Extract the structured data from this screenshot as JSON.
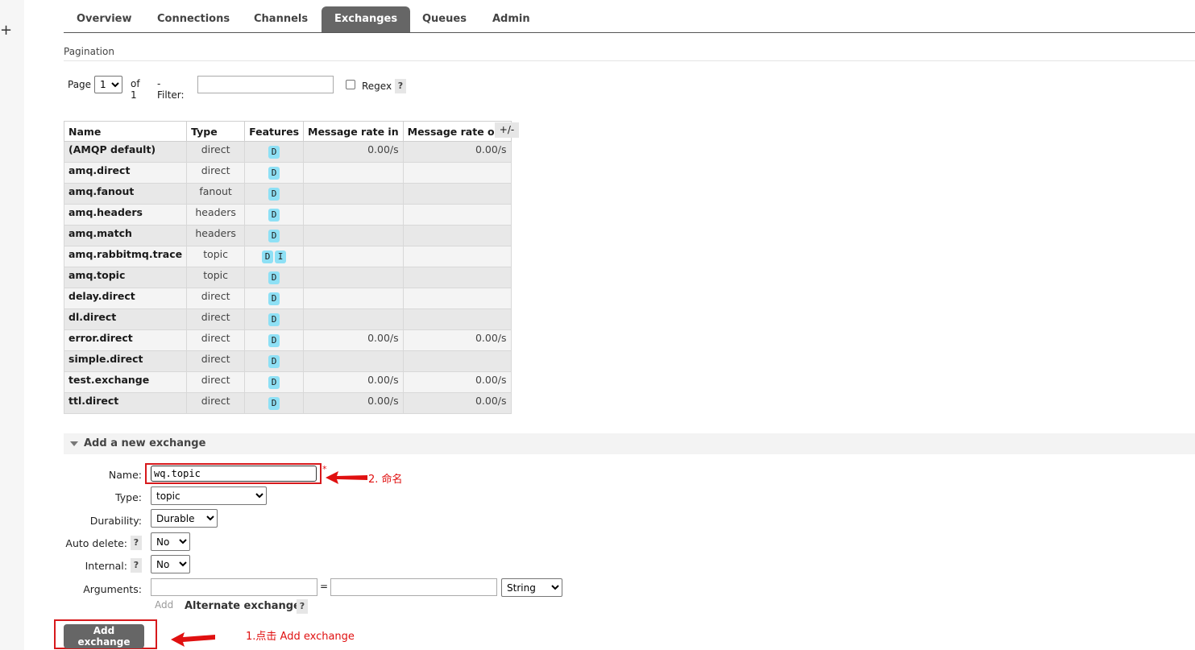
{
  "tabs": [
    "Overview",
    "Connections",
    "Channels",
    "Exchanges",
    "Queues",
    "Admin"
  ],
  "section_label": "Pagination",
  "pager": {
    "page_label": "Page",
    "page_value": "1",
    "of_label": "of 1",
    "filter_label": "- Filter:",
    "filter_value": "",
    "regex_label": "Regex",
    "help": "?"
  },
  "table": {
    "headers": [
      "Name",
      "Type",
      "Features",
      "Message rate in",
      "Message rate out"
    ],
    "toggle": "+/-",
    "rows": [
      {
        "name": "(AMQP default)",
        "type": "direct",
        "features": [
          "D"
        ],
        "rate_in": "0.00/s",
        "rate_out": "0.00/s"
      },
      {
        "name": "amq.direct",
        "type": "direct",
        "features": [
          "D"
        ],
        "rate_in": "",
        "rate_out": ""
      },
      {
        "name": "amq.fanout",
        "type": "fanout",
        "features": [
          "D"
        ],
        "rate_in": "",
        "rate_out": ""
      },
      {
        "name": "amq.headers",
        "type": "headers",
        "features": [
          "D"
        ],
        "rate_in": "",
        "rate_out": ""
      },
      {
        "name": "amq.match",
        "type": "headers",
        "features": [
          "D"
        ],
        "rate_in": "",
        "rate_out": ""
      },
      {
        "name": "amq.rabbitmq.trace",
        "type": "topic",
        "features": [
          "D",
          "I"
        ],
        "rate_in": "",
        "rate_out": ""
      },
      {
        "name": "amq.topic",
        "type": "topic",
        "features": [
          "D"
        ],
        "rate_in": "",
        "rate_out": ""
      },
      {
        "name": "delay.direct",
        "type": "direct",
        "features": [
          "D"
        ],
        "rate_in": "",
        "rate_out": ""
      },
      {
        "name": "dl.direct",
        "type": "direct",
        "features": [
          "D"
        ],
        "rate_in": "",
        "rate_out": ""
      },
      {
        "name": "error.direct",
        "type": "direct",
        "features": [
          "D"
        ],
        "rate_in": "0.00/s",
        "rate_out": "0.00/s"
      },
      {
        "name": "simple.direct",
        "type": "direct",
        "features": [
          "D"
        ],
        "rate_in": "",
        "rate_out": ""
      },
      {
        "name": "test.exchange",
        "type": "direct",
        "features": [
          "D"
        ],
        "rate_in": "0.00/s",
        "rate_out": "0.00/s"
      },
      {
        "name": "ttl.direct",
        "type": "direct",
        "features": [
          "D"
        ],
        "rate_in": "0.00/s",
        "rate_out": "0.00/s"
      }
    ]
  },
  "add_form": {
    "title": "Add a new exchange",
    "name_label": "Name:",
    "name_value": "wq.topic",
    "required_mark": "*",
    "type_label": "Type:",
    "type_value": "topic",
    "durability_label": "Durability:",
    "durability_value": "Durable",
    "auto_delete_label": "Auto delete:",
    "auto_delete_value": "No",
    "internal_label": "Internal:",
    "internal_value": "No",
    "arguments_label": "Arguments:",
    "equals": "=",
    "arg_type_value": "String",
    "add_link": "Add",
    "alternate_exchange": "Alternate exchange",
    "submit": "Add exchange"
  },
  "annotations": {
    "name_note": "2. 命名",
    "submit_note": "1.点击 Add exchange"
  },
  "colors": {
    "annotation": "#e01010",
    "badge": "#8ee0f5",
    "active_tab": "#666666"
  }
}
